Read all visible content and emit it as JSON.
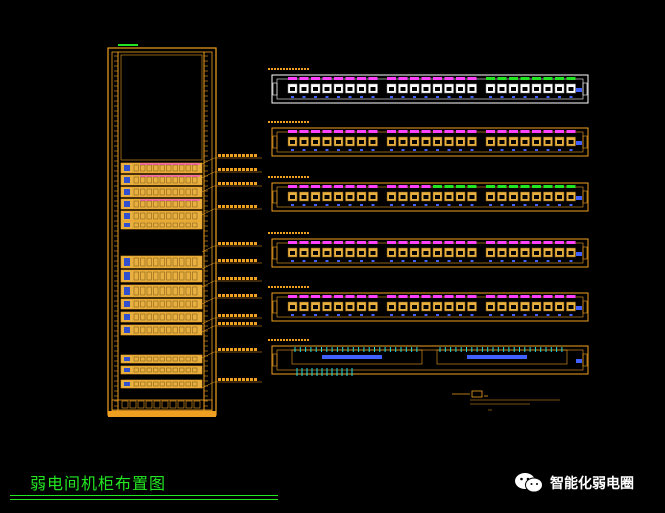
{
  "drawing_title": "弱电间机柜布置图",
  "watermark": {
    "text": "智能化弱电圈",
    "icon": "wechat-icon"
  },
  "colors": {
    "background": "#000000",
    "frame": "#f0a020",
    "panel_fill": "#e8b040",
    "white_panel": "#ffffff",
    "magenta": "#ff40ff",
    "green": "#22e622",
    "cyan": "#20e0e0",
    "blue_label": "#4060ff"
  },
  "cabinet": {
    "units": 42,
    "patch_panels": 9,
    "switches": 4,
    "fiber_box": 1,
    "pdu": 1
  },
  "panel_rows": [
    {
      "type": "white",
      "labels_color": "magenta-green",
      "ports_per_group": 8,
      "groups": 3
    },
    {
      "type": "gold",
      "labels_color": "magenta",
      "ports_per_group": 8,
      "groups": 3
    },
    {
      "type": "gold",
      "labels_color": "magenta-green",
      "ports_per_group": 8,
      "groups": 3
    },
    {
      "type": "gold",
      "labels_color": "magenta",
      "ports_per_group": 8,
      "groups": 3
    },
    {
      "type": "gold",
      "labels_color": "magenta",
      "ports_per_group": 8,
      "groups": 3
    },
    {
      "type": "fiber",
      "labels_color": "cyan",
      "ports_per_group": 12,
      "groups": 2
    }
  ]
}
